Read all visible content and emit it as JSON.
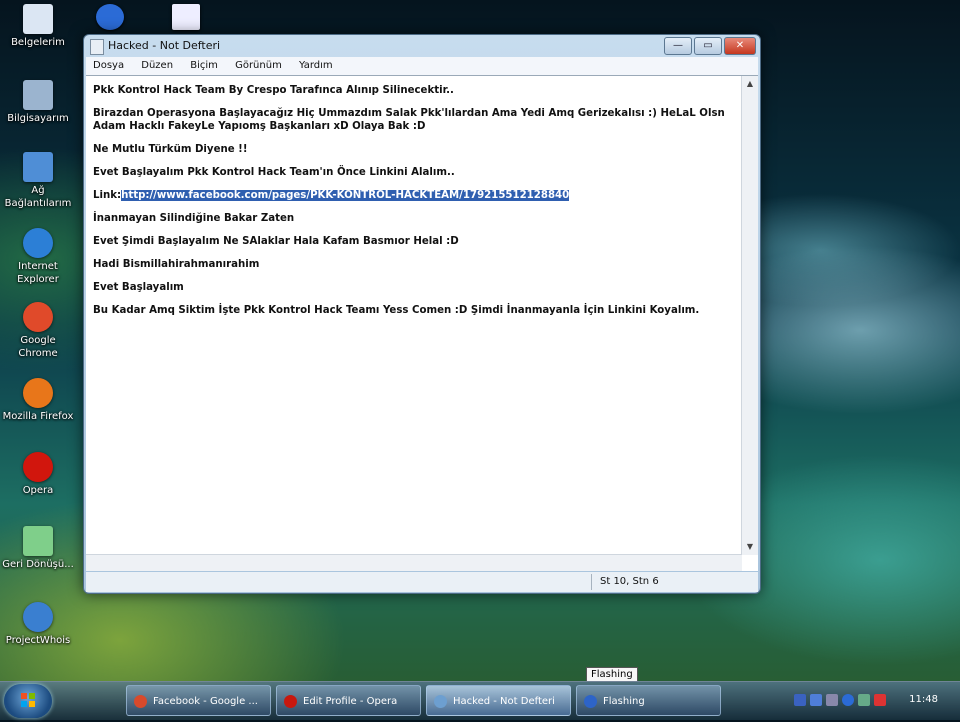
{
  "desktop_icons": [
    {
      "label": "Belgelerim",
      "icon": "documents-icon"
    },
    {
      "label": "Bilgisayarım",
      "icon": "computer-icon"
    },
    {
      "label": "Ağ Bağlantılarım",
      "icon": "network-icon"
    },
    {
      "label": "Internet Explorer",
      "icon": "internet-explorer-icon"
    },
    {
      "label": "Google Chrome",
      "icon": "chrome-icon"
    },
    {
      "label": "Mozilla Firefox",
      "icon": "firefox-icon"
    },
    {
      "label": "Opera",
      "icon": "opera-icon"
    },
    {
      "label": "Geri Dönüşü...",
      "icon": "recycle-bin-icon"
    },
    {
      "label": "ProjectWhois",
      "icon": "projectwhois-icon"
    }
  ],
  "window": {
    "title": "Hacked - Not Defteri",
    "minimize": "—",
    "maximize": "▭",
    "close": "✕",
    "menu": [
      "Dosya",
      "Düzen",
      "Biçim",
      "Görünüm",
      "Yardım"
    ],
    "lines": [
      "Pkk Kontrol Hack Team By Crespo Tarafınca Alınıp Silinecektir..",
      "Birazdan Operasyona Başlayacağız Hiç Ummazdım Salak Pkk'lılardan Ama Yedi Amq Gerizekalısı :) HeLaL Olsn Adam Hacklı FakeyLe Yapıomş Başkanları xD Olaya Bak :D",
      "Ne Mutlu Türküm Diyene !!",
      "Evet Başlayalım Pkk Kontrol Hack Team'ın Önce Linkini Alalım..",
      "",
      "İnanmayan Silindiğine Bakar Zaten",
      "Evet Şimdi Başlayalım Ne SAlaklar Hala Kafam Basmıor Helal :D",
      "Hadi Bismillahirahmanırahim",
      "Evet Başlayalım",
      "Bu Kadar Amq Siktim İşte Pkk Kontrol Hack Teamı Yess Comen :D Şimdi İnanmayanla İçin Linkini Koyalım."
    ],
    "link_prefix": "Link:",
    "link_url": "http://www.facebook.com/pages/PKK-KONTROL-HACKTEAM/179215512128840",
    "status_position": "St 10, Stn 6"
  },
  "taskbar": {
    "items": [
      {
        "label": "Facebook - Google ...",
        "color": "#d84a2c"
      },
      {
        "label": "Edit Profile - Opera",
        "color": "#c8180e"
      },
      {
        "label": "Hacked - Not Defteri",
        "color": "#6d9fd0"
      },
      {
        "label": "Flashing",
        "color": "#2d64c8"
      }
    ],
    "tooltip": "Flashing",
    "clock": "11:48"
  }
}
